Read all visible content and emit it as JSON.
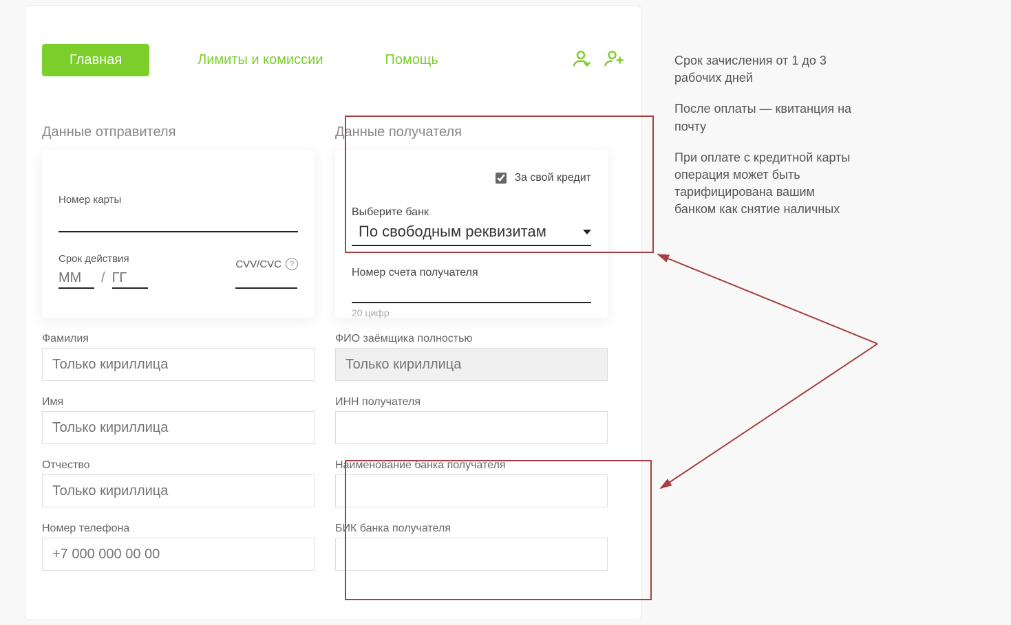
{
  "nav": {
    "home": "Главная",
    "limits": "Лимиты и комиссии",
    "help": "Помощь"
  },
  "sender": {
    "title": "Данные отправителя",
    "card_number_label": "Номер карты",
    "expiry_label": "Срок действия",
    "mm_placeholder": "ММ",
    "yy_placeholder": "ГГ",
    "cvv_label": "CVV/CVC",
    "surname_label": "Фамилия",
    "surname_placeholder": "Только кириллица",
    "name_label": "Имя",
    "name_placeholder": "Только кириллица",
    "patronymic_label": "Отчество",
    "patronymic_placeholder": "Только кириллица",
    "phone_label": "Номер телефона",
    "phone_placeholder": "+7 000 000 00 00"
  },
  "recipient": {
    "title": "Данные получателя",
    "for_own_credit": "За свой кредит",
    "for_own_credit_checked": true,
    "select_bank_label": "Выберите банк",
    "select_bank_value": "По свободным реквизитам",
    "account_label": "Номер счета получателя",
    "account_hint": "20 цифр",
    "fio_label": "ФИО заёмщика полностью",
    "fio_placeholder": "Только кириллица",
    "inn_label": "ИНН получателя",
    "bank_name_label": "Наименование банка получателя",
    "bik_label": "БИК банка получателя"
  },
  "sidebar": {
    "p1": "Срок зачисления от 1 до 3 рабочих дней",
    "p2": "После оплаты — квитанция на почту",
    "p3": "При оплате с кредитной карты операция может быть тарифицирована вашим банком как снятие наличных"
  },
  "colors": {
    "accent": "#7cce2b",
    "highlight": "#a64040"
  }
}
